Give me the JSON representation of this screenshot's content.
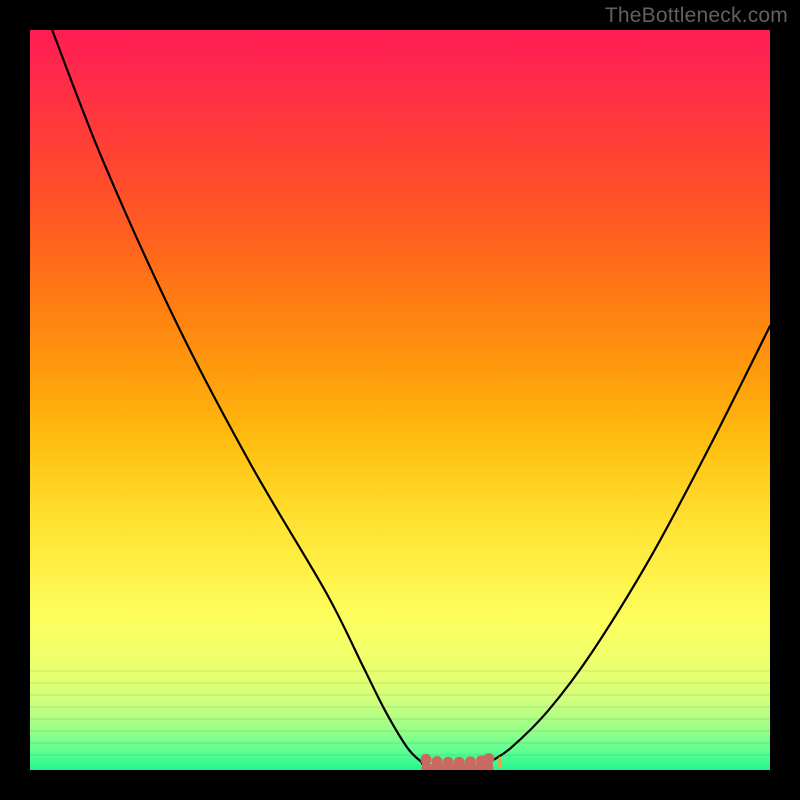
{
  "watermark": {
    "text": "TheBottleneck.com"
  },
  "colors": {
    "black_line": "#000000",
    "marker_fill": "#c96a62",
    "marker_highlight": "#ff9a40"
  },
  "chart_data": {
    "type": "line",
    "title": "",
    "xlabel": "",
    "ylabel": "",
    "xlim": [
      0,
      100
    ],
    "ylim": [
      0,
      100
    ],
    "grid": false,
    "legend": false,
    "series": [
      {
        "name": "left-branch",
        "x": [
          3,
          10,
          20,
          30,
          40,
          45,
          48,
          51,
          53
        ],
        "y": [
          100,
          82,
          60,
          41,
          24,
          14,
          8,
          3,
          1
        ]
      },
      {
        "name": "right-branch",
        "x": [
          62,
          65,
          70,
          76,
          84,
          92,
          100
        ],
        "y": [
          1,
          3,
          8,
          16,
          29,
          44,
          60
        ]
      },
      {
        "name": "plateau",
        "x": [
          53,
          55,
          57,
          59,
          61,
          62
        ],
        "y": [
          0.8,
          0.5,
          0.5,
          0.5,
          0.6,
          0.9
        ]
      }
    ],
    "markers": {
      "name": "optimum-range",
      "x": [
        53.5,
        55,
        56.5,
        58,
        59.5,
        61,
        62
      ],
      "y": [
        0.9,
        0.6,
        0.5,
        0.5,
        0.55,
        0.7,
        1.0
      ]
    }
  }
}
